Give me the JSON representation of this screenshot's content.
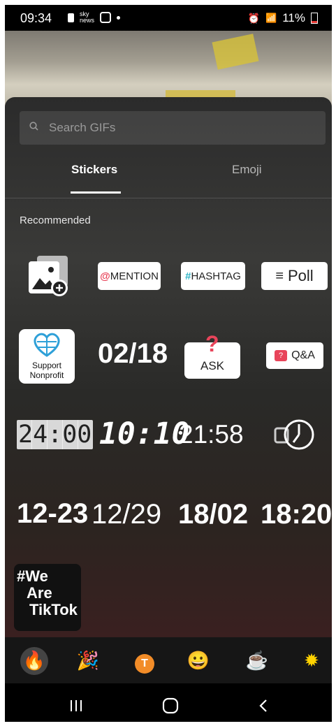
{
  "status_bar": {
    "time": "09:34",
    "left_icons": [
      "notification-icon",
      "sky-news-icon",
      "instagram-icon",
      "dot-icon"
    ],
    "battery": "11%"
  },
  "search": {
    "placeholder": "Search GIFs"
  },
  "tabs": [
    {
      "label": "Stickers",
      "active": true
    },
    {
      "label": "Emoji",
      "active": false
    }
  ],
  "section_title": "Recommended",
  "stickers": {
    "mention": "MENTION",
    "mention_prefix": "@",
    "hashtag": "HASHTAG",
    "hashtag_prefix": "#",
    "poll": "Poll",
    "support_line1": "Support",
    "support_line2": "Nonprofit",
    "date1": "02/18",
    "ask": "ASK",
    "qa": "Q&A",
    "clock1": "24:00",
    "clock2": "10:10",
    "clock3": "21:58",
    "date2": "12-23",
    "date3": "12/29",
    "date4": "18/02",
    "time4": "18:20",
    "we_are_line1": "#We",
    "we_are_line2": "Are",
    "we_are_line3": "TikTok"
  },
  "categories": [
    "fire-icon",
    "party-popper-icon",
    "letter-t-icon",
    "grinning-face-icon",
    "coffee-icon",
    "sun-icon"
  ],
  "colors": {
    "accent_red": "#e53935",
    "pill_bg": "#ffffff",
    "panel_bg": "#2b2b2b"
  }
}
